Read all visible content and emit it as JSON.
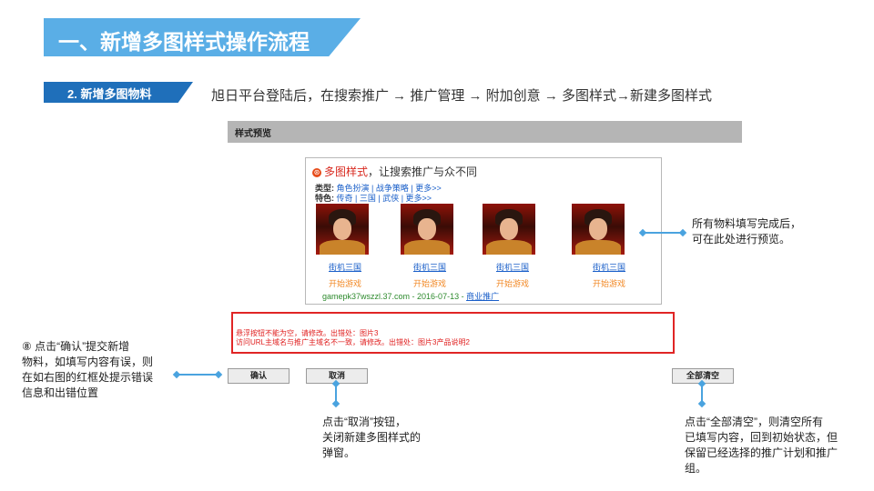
{
  "title": "一、新增多图样式操作流程",
  "section": "2. 新增多图物料",
  "nav_path": "旭日平台登陆后，在搜索推广 → 推广管理 → 附加创意 → 多图样式→新建多图样式",
  "panel": {
    "header": "样式预览",
    "brand_prefix": "多图样式",
    "brand_suffix": "，让搜索推广与众不同",
    "type_label": "类型:",
    "type_values": "角色扮演 | 战争策略 | 更多>>",
    "feature_label": "特色:",
    "feature_values": "传奇 | 三国 | 武侠 | 更多>>",
    "items": [
      {
        "title": "街机三国",
        "action": "开始游戏"
      },
      {
        "title": "街机三国",
        "action": "开始游戏"
      },
      {
        "title": "街机三国",
        "action": "开始游戏"
      },
      {
        "title": "街机三国",
        "action": "开始游戏"
      }
    ],
    "url": "gamepk37wszzl.37.com - 2016-07-13 - ",
    "url_link": "商业推广",
    "errors": [
      "悬浮按钮不能为空，请修改。出错处：图片3",
      "访问URL主域名与推广主域名不一致，请修改。出错处：图片3产品说明2"
    ],
    "confirm_label": "确认",
    "cancel_label": "取消",
    "clear_label": "全部清空"
  },
  "notes": {
    "preview": "所有物料填写完成后，\n可在此处进行预览。",
    "confirm": "⑧ 点击“确认”提交新增\n物料，如填写内容有误，则\n在如右图的红框处提示错误\n信息和出错位置",
    "cancel": "点击“取消”按钮，\n关闭新建多图样式的\n弹窗。",
    "clear": "点击“全部清空”，则清空所有\n已填写内容，回到初始状态，但\n保留已经选择的推广计划和推广\n组。"
  },
  "colors": {
    "banner": "#5aaee6",
    "section_tag": "#1f6fba",
    "error_border": "#e02525",
    "connector": "#4aa3df"
  }
}
